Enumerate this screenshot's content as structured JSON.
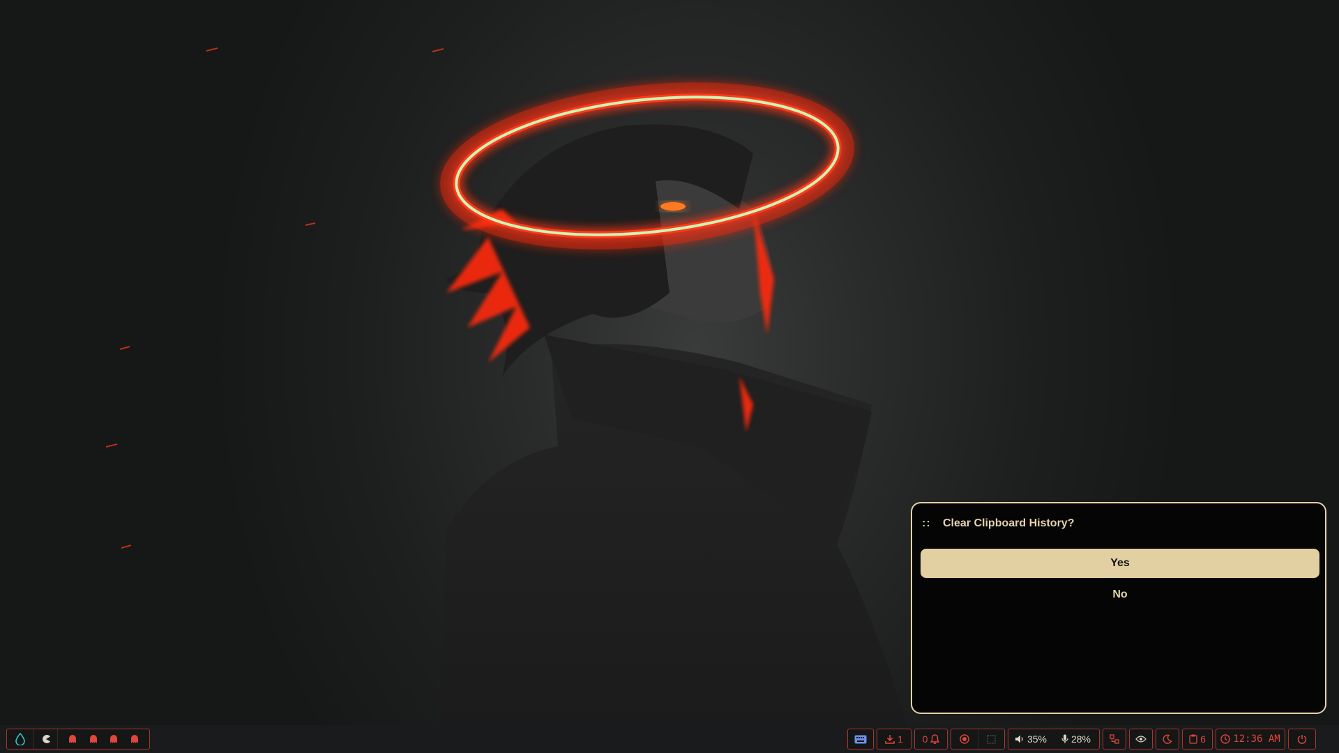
{
  "dialog": {
    "prompt": "::",
    "title": "Clear Clipboard History?",
    "options": [
      "Yes",
      "No"
    ],
    "selected": "Yes"
  },
  "taskbar": {
    "launcher_icon": "droplet-icon",
    "mode_icon": "pacman-icon",
    "workspaces": [
      "ghost-icon",
      "ghost-icon",
      "ghost-icon",
      "ghost-icon"
    ],
    "keyboard_icon": "keyboard-icon",
    "updates_count": "1",
    "notifications_count": "0",
    "volume": "35%",
    "mic": "28%",
    "clipboard_count": "6",
    "clock": "12:36 AM"
  },
  "colors": {
    "accent": "#e2cfa2",
    "taskbar_red": "#e0463a",
    "border_red": "#a8362a",
    "launcher_teal": "#2fc3c0",
    "keyboard_blue": "#6f8ee8"
  }
}
